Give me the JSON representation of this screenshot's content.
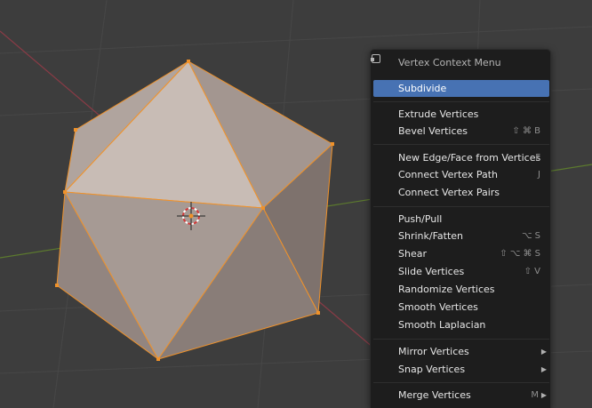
{
  "menu": {
    "title": "Vertex Context Menu",
    "subdivide": "Subdivide",
    "extrude": "Extrude Vertices",
    "bevel": "Bevel Vertices",
    "bevel_sc": "⇧ ⌘ B",
    "new_edge": "New Edge/Face from Vertices",
    "new_edge_sc": "F",
    "connect_path": "Connect Vertex Path",
    "connect_path_sc": "J",
    "connect_pairs": "Connect Vertex Pairs",
    "push_pull": "Push/Pull",
    "shrink": "Shrink/Fatten",
    "shrink_sc": "⌥ S",
    "shear": "Shear",
    "shear_sc": "⇧ ⌥ ⌘ S",
    "slide": "Slide Vertices",
    "slide_sc": "⇧ V",
    "randomize": "Randomize Vertices",
    "smooth": "Smooth Vertices",
    "smooth_lap": "Smooth Laplacian",
    "mirror": "Mirror Vertices",
    "snap": "Snap Vertices",
    "merge": "Merge Vertices",
    "merge_sc": "M"
  },
  "colors": {
    "background": "#3d3d3d",
    "menu_bg": "#1d1d1d",
    "highlight": "#4772b3",
    "mesh_edge": "#f0922a",
    "axis_x": "#8a3b46",
    "axis_y": "#5c7a2e"
  }
}
